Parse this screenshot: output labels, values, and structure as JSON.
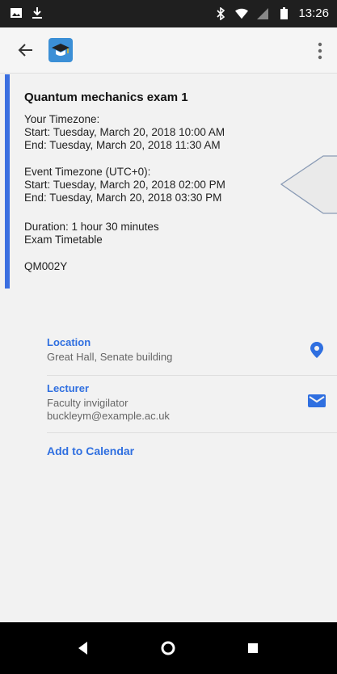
{
  "status_bar": {
    "time": "13:26",
    "icons": [
      "image-icon",
      "download-icon",
      "bluetooth-icon",
      "wifi-icon",
      "signal-icon",
      "battery-icon"
    ]
  },
  "app_bar": {
    "back_icon": "back-arrow-icon",
    "logo_icon": "graduation-cap-icon",
    "menu_icon": "more-vert-icon"
  },
  "event": {
    "title": "Quantum mechanics exam 1",
    "your_tz_label": "Your Timezone:",
    "your_start": "Start: Tuesday, March 20, 2018 10:00 AM",
    "your_end": "End: Tuesday, March 20, 2018 11:30 AM",
    "event_tz_label": "Event Timezone (UTC+0):",
    "event_start": "Start: Tuesday, March 20, 2018 02:00 PM",
    "event_end": "End: Tuesday, March 20, 2018 03:30 PM",
    "duration": "Duration: 1 hour 30 minutes",
    "category": "Exam Timetable",
    "code": "QM002Y"
  },
  "details": {
    "location_title": "Location",
    "location_value": "Great Hall, Senate building",
    "lecturer_title": "Lecturer",
    "lecturer_name": "Faculty invigilator",
    "lecturer_email": "buckleym@example.ac.uk",
    "add_to_calendar": "Add to Calendar"
  },
  "colors": {
    "accent": "#3b6fe0",
    "link": "#2f6fe0"
  }
}
